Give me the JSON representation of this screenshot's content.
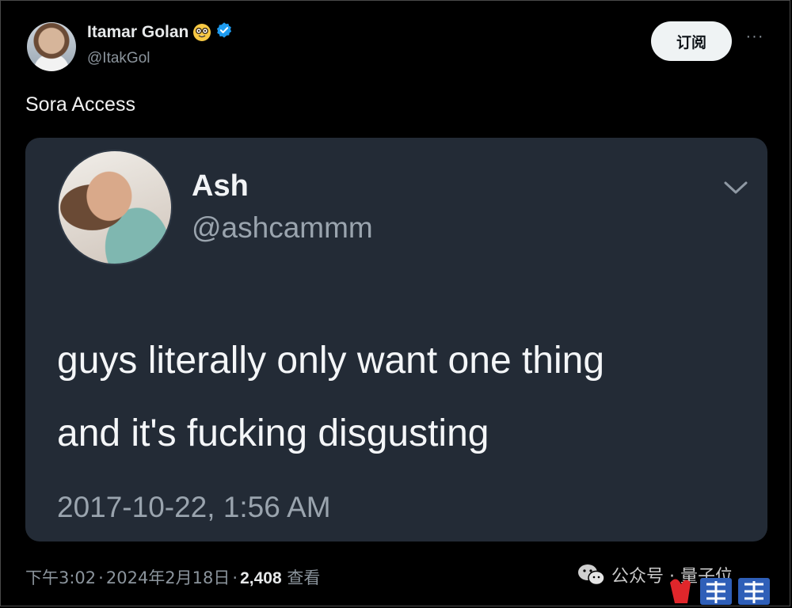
{
  "author": {
    "display_name": "Itamar Golan",
    "handle": "@ItakGol",
    "emoji_icon": "nerd-face-emoji",
    "badge_icon": "verified-badge",
    "badge_color": "#1d9bf0"
  },
  "actions": {
    "subscribe_label": "订阅",
    "more_label": "···"
  },
  "tweet": {
    "text": "Sora Access"
  },
  "quoted_screenshot": {
    "name": "Ash",
    "handle": "@ashcammm",
    "body_line1": "guys literally only want one thing",
    "body_line2": "and it's fucking disgusting",
    "timestamp": "2017-10-22, 1:56 AM"
  },
  "footer": {
    "time": "下午3:02",
    "date": "2024年2月18日",
    "views": "2,408",
    "views_label": "查看"
  },
  "watermark": {
    "source": "公众号 · 量子位",
    "icon": "wechat-icon"
  }
}
